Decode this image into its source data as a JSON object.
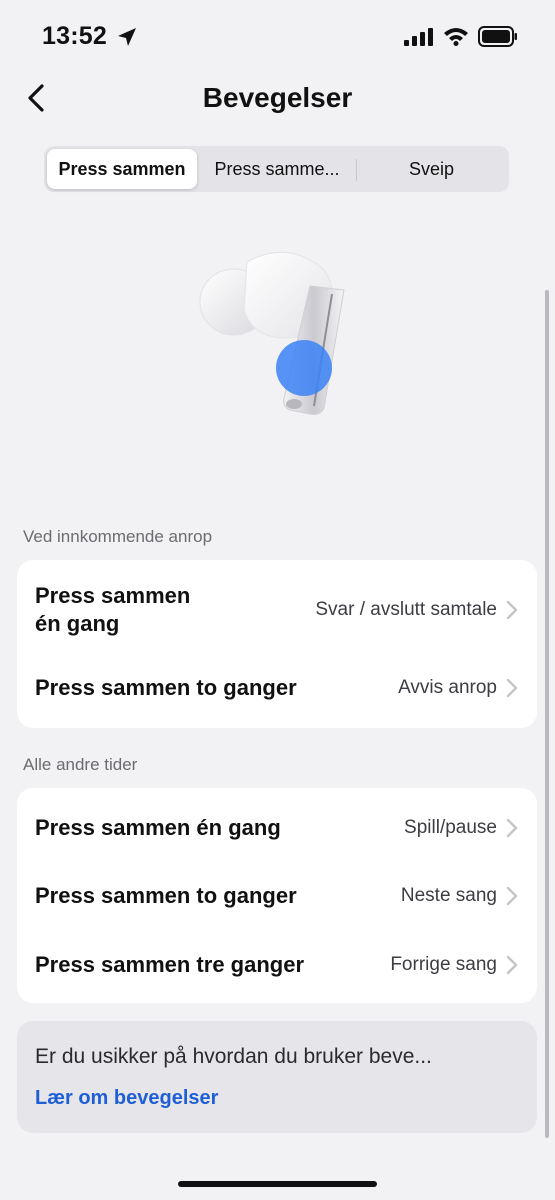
{
  "status_bar": {
    "time": "13:52",
    "icons": [
      "location-arrow-icon",
      "cellular-signal-icon",
      "wifi-icon",
      "battery-icon"
    ]
  },
  "header": {
    "title": "Bevegelser",
    "back_icon": "chevron-left-icon"
  },
  "tabs": [
    {
      "label": "Press sammen",
      "selected": true
    },
    {
      "label": "Press samme...",
      "selected": false
    },
    {
      "label": "Sveip",
      "selected": false
    }
  ],
  "illustration": {
    "icon": "earbud-illustration",
    "highlight_color": "#3b82f6"
  },
  "sections": [
    {
      "header": "Ved innkommende anrop",
      "rows": [
        {
          "label_line1": "Press sammen",
          "label_line2": "én gang",
          "value": "Svar / avslutt samtale"
        },
        {
          "label": "Press sammen to ganger",
          "value": "Avvis anrop"
        }
      ]
    },
    {
      "header": "Alle andre tider",
      "rows": [
        {
          "label": "Press sammen én gang",
          "value": "Spill/pause"
        },
        {
          "label": "Press sammen to ganger",
          "value": "Neste sang"
        },
        {
          "label": "Press sammen tre ganger",
          "value": "Forrige sang"
        }
      ]
    }
  ],
  "help": {
    "text": "Er du usikker på hvordan du bruker beve...",
    "link": "Lær om bevegelser"
  },
  "colors": {
    "background": "#f2f2f4",
    "card": "#ffffff",
    "link": "#1f5fd6",
    "accent_dot": "#3b82f6"
  }
}
